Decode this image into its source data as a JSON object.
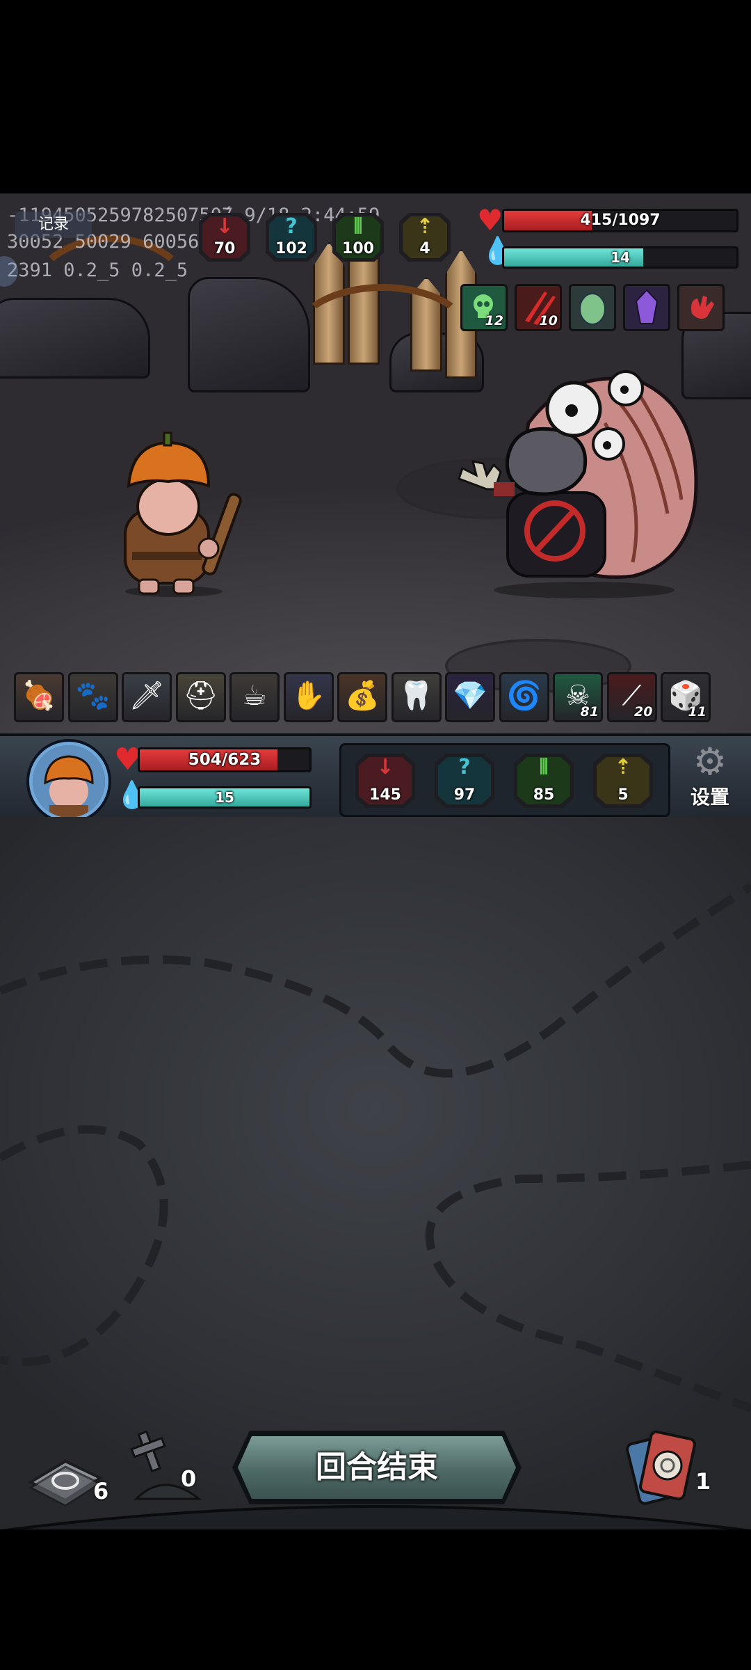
{
  "debug": {
    "line1": "-119450525978250750́7 9/18 2:44:59",
    "line2": "30052 50029 60056",
    "line3": "2391 0.2_5 0.2_5",
    "record_button": "记录"
  },
  "enemy_stats": {
    "attack": "70",
    "defense": "102",
    "speed": "100",
    "luck": "4"
  },
  "enemy": {
    "hp": "415/1097",
    "hp_fraction": 0.378,
    "energy": "14",
    "energy_fraction": 0.6,
    "statuses": [
      {
        "icon": "skull-poison-icon",
        "count": "12"
      },
      {
        "icon": "bleed-claw-icon",
        "count": "10"
      },
      {
        "icon": "dragon-egg-icon",
        "count": ""
      },
      {
        "icon": "purple-crystal-icon",
        "count": ""
      },
      {
        "icon": "red-hand-icon",
        "count": ""
      }
    ]
  },
  "items": [
    {
      "icon": "meat-icon",
      "count": ""
    },
    {
      "icon": "beast-pelt-icon",
      "count": ""
    },
    {
      "icon": "dagger-icon",
      "count": ""
    },
    {
      "icon": "helmet-icon",
      "count": ""
    },
    {
      "icon": "teacup-icon",
      "count": ""
    },
    {
      "icon": "gauntlet-icon",
      "count": ""
    },
    {
      "icon": "sack-icon",
      "count": ""
    },
    {
      "icon": "fang-icon",
      "count": ""
    },
    {
      "icon": "purple-crystal-icon",
      "count": ""
    },
    {
      "icon": "vortex-rune-icon",
      "count": ""
    },
    {
      "icon": "skull-poison-icon",
      "count": "81"
    },
    {
      "icon": "bleed-claw-icon",
      "count": "20"
    },
    {
      "icon": "dice-icon",
      "count": "11"
    }
  ],
  "player": {
    "hp": "504/623",
    "hp_fraction": 0.81,
    "energy": "15",
    "energy_fraction": 1.0
  },
  "player_stats": {
    "attack": "145",
    "defense": "97",
    "speed": "85",
    "luck": "5"
  },
  "settings_label": "设置",
  "bottom": {
    "draw_pile": "6",
    "discard_pile": "0",
    "end_turn_label": "回合结束",
    "exhaust_pile": "1"
  },
  "colors": {
    "hp": "#d2292a",
    "energy": "#4fd0c3",
    "attack": "#c8383a",
    "defense": "#3fb8c8",
    "speed": "#56c14a",
    "luck": "#d8c53c"
  }
}
